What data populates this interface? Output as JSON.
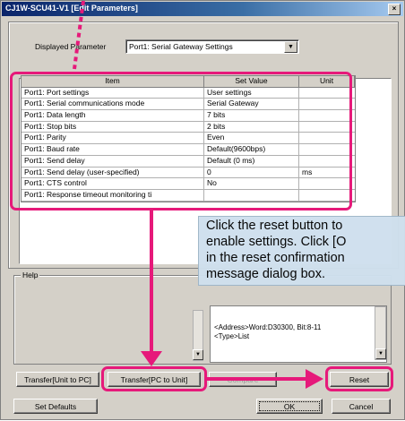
{
  "window": {
    "title": "CJ1W-SCU41-V1 [Edit Parameters]",
    "close_label": "×"
  },
  "displayed_parameter": {
    "label": "Displayed Parameter",
    "value": "Port1: Serial Gateway Settings",
    "arrow": "▼"
  },
  "table": {
    "headers": [
      "Item",
      "Set Value",
      "Unit"
    ],
    "rows": [
      {
        "item": "Port1: Port settings",
        "value": "User settings",
        "unit": ""
      },
      {
        "item": "Port1: Serial communications mode",
        "value": "Serial Gateway",
        "unit": ""
      },
      {
        "item": "Port1: Data length",
        "value": "7 bits",
        "unit": ""
      },
      {
        "item": "Port1: Stop bits",
        "value": "2 bits",
        "unit": ""
      },
      {
        "item": "Port1: Parity",
        "value": "Even",
        "unit": ""
      },
      {
        "item": "Port1: Baud rate",
        "value": "Default(9600bps)",
        "unit": ""
      },
      {
        "item": "Port1: Send delay",
        "value": "Default (0 ms)",
        "unit": ""
      },
      {
        "item": "Port1: Send delay (user-specified)",
        "value": "0",
        "unit": "ms"
      },
      {
        "item": "Port1: CTS control",
        "value": "No",
        "unit": ""
      },
      {
        "item": "Port1: Response timeout monitoring ti",
        "value": "",
        "unit": ""
      }
    ]
  },
  "help": {
    "label": "Help",
    "address_line": "<Address>Word:D30300, Bit:8-11",
    "type_line": "<Type>List"
  },
  "callout": {
    "lines": [
      "Click the reset button to",
      "enable settings. Click [O",
      "in the reset confirmation",
      "message dialog box."
    ]
  },
  "buttons": {
    "transfer_unit_to_pc": "Transfer[Unit to PC]",
    "transfer_pc_to_unit": "Transfer[PC to Unit]",
    "compare": "Compare",
    "reset": "Reset",
    "set_defaults": "Set Defaults",
    "ok": "OK",
    "cancel": "Cancel"
  },
  "colors": {
    "highlight": "#e6197a",
    "callout_bg": "#cfe0ee",
    "titlebar": "#0a246a",
    "dialog_bg": "#d4d0c8"
  }
}
